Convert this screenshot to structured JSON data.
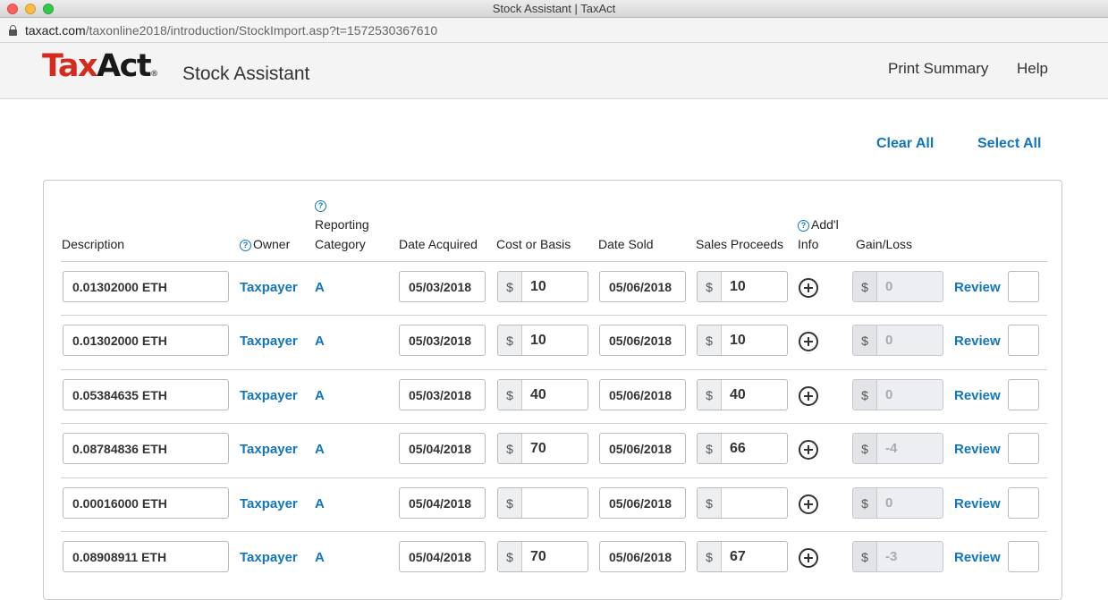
{
  "window": {
    "title": "Stock Assistant | TaxAct"
  },
  "browser": {
    "url_host": "taxact.com",
    "url_path": "/taxonline2018/introduction/StockImport.asp?t=1572530367610"
  },
  "header": {
    "logo_tax": "Tax",
    "logo_act": "Act",
    "logo_reg": "®",
    "product": "Stock Assistant",
    "nav": {
      "print_summary": "Print Summary",
      "help": "Help"
    }
  },
  "actions": {
    "clear_all": "Clear All",
    "select_all": "Select All"
  },
  "table": {
    "help_glyph": "?",
    "currency_symbol": "$",
    "columns": {
      "description": "Description",
      "owner": "Owner",
      "reporting_line1": "Reporting",
      "reporting_line2": "Category",
      "date_acquired": "Date Acquired",
      "cost_basis": "Cost or Basis",
      "date_sold": "Date Sold",
      "sales_proceeds": "Sales Proceeds",
      "addl_line1": "Add'l",
      "addl_line2": "Info",
      "gain_loss": "Gain/Loss"
    },
    "rows": [
      {
        "description": "0.01302000 ETH",
        "owner": "Taxpayer",
        "category": "A",
        "date_acquired": "05/03/2018",
        "cost": "10",
        "date_sold": "05/06/2018",
        "proceeds": "10",
        "gain_loss": "0",
        "review": "Review"
      },
      {
        "description": "0.01302000 ETH",
        "owner": "Taxpayer",
        "category": "A",
        "date_acquired": "05/03/2018",
        "cost": "10",
        "date_sold": "05/06/2018",
        "proceeds": "10",
        "gain_loss": "0",
        "review": "Review"
      },
      {
        "description": "0.05384635 ETH",
        "owner": "Taxpayer",
        "category": "A",
        "date_acquired": "05/03/2018",
        "cost": "40",
        "date_sold": "05/06/2018",
        "proceeds": "40",
        "gain_loss": "0",
        "review": "Review"
      },
      {
        "description": "0.08784836 ETH",
        "owner": "Taxpayer",
        "category": "A",
        "date_acquired": "05/04/2018",
        "cost": "70",
        "date_sold": "05/06/2018",
        "proceeds": "66",
        "gain_loss": "-4",
        "review": "Review"
      },
      {
        "description": "0.00016000 ETH",
        "owner": "Taxpayer",
        "category": "A",
        "date_acquired": "05/04/2018",
        "cost": "",
        "date_sold": "05/06/2018",
        "proceeds": "",
        "gain_loss": "0",
        "review": "Review"
      },
      {
        "description": "0.08908911 ETH",
        "owner": "Taxpayer",
        "category": "A",
        "date_acquired": "05/04/2018",
        "cost": "70",
        "date_sold": "05/06/2018",
        "proceeds": "67",
        "gain_loss": "-3",
        "review": "Review"
      }
    ]
  },
  "colors": {
    "accent": "#1276be",
    "brand_red": "#d52b1e"
  }
}
